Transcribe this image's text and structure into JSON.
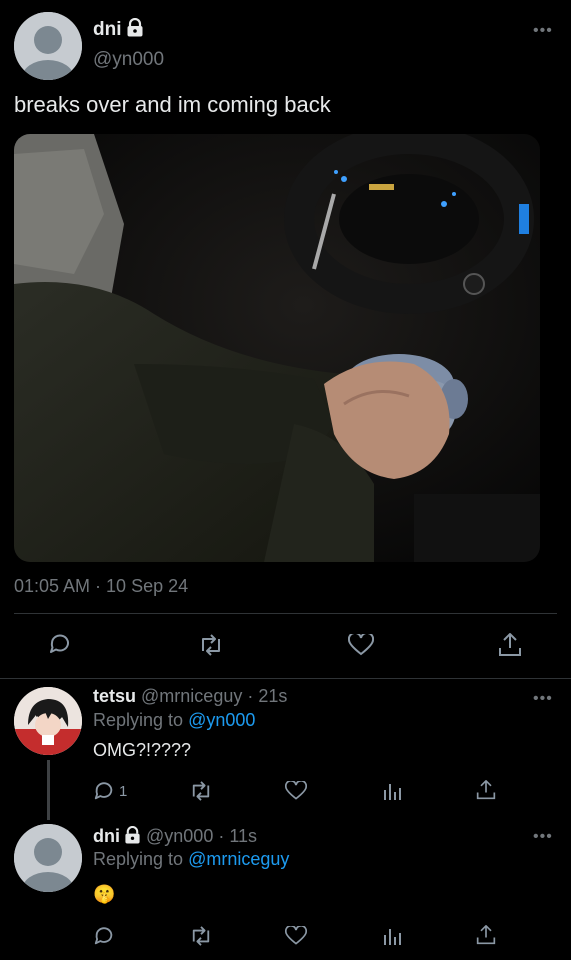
{
  "main_tweet": {
    "display_name": "dni",
    "handle": "@yn000",
    "text": "breaks over and im coming back",
    "timestamp": "01:05 AM · 10 Sep 24",
    "more_label": "•••"
  },
  "replies": [
    {
      "display_name": "tetsu",
      "handle": "@mrniceguy",
      "time": "· 21s",
      "replying_prefix": "Replying to",
      "replying_to": "@yn000",
      "text": "OMG?!????",
      "reply_count": "1",
      "more_label": "•••"
    },
    {
      "display_name": "dni",
      "handle": "@yn000",
      "time": "· 11s",
      "replying_prefix": "Replying to",
      "replying_to": "@mrniceguy",
      "text": "🤫",
      "more_label": "•••"
    }
  ],
  "colors": {
    "background": "#000000",
    "text": "#e7e9ea",
    "secondary": "#71767b",
    "link": "#1d9bf0",
    "divider": "#2f3336"
  }
}
